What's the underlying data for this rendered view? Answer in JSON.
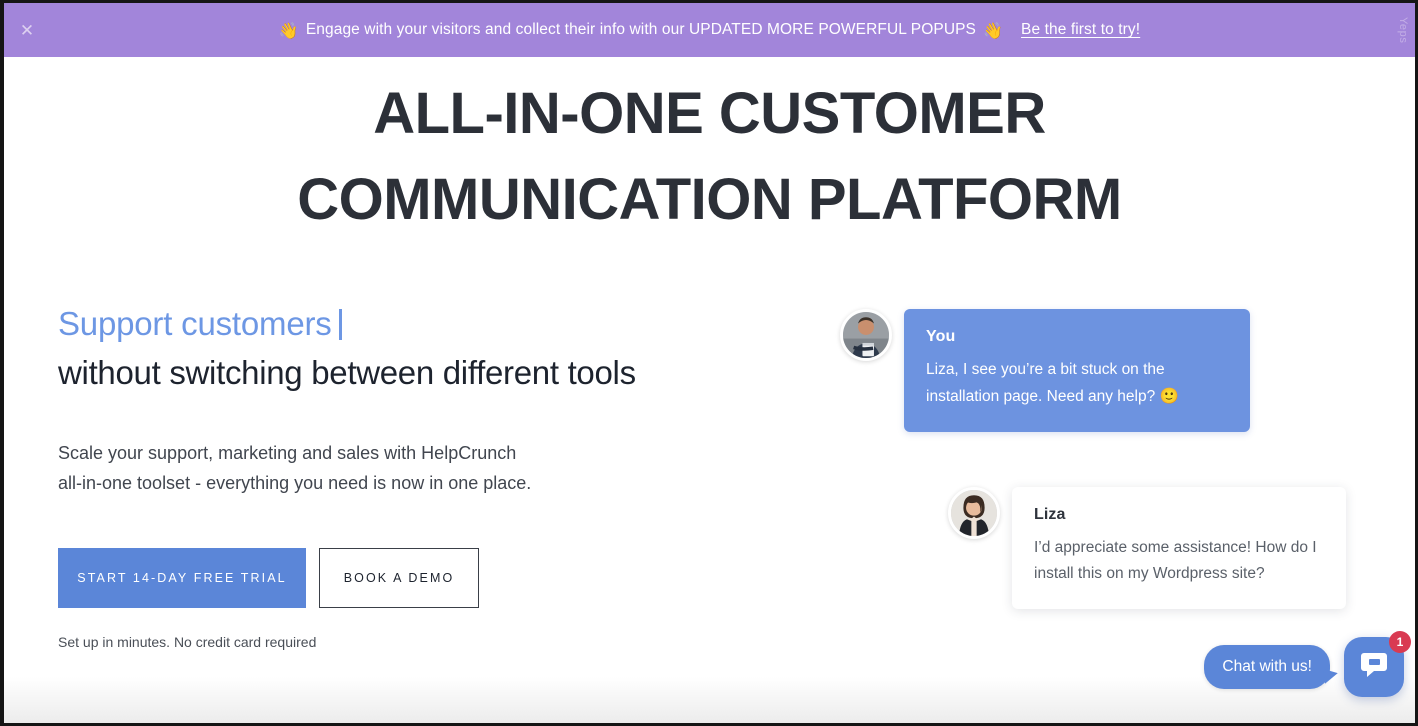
{
  "banner": {
    "close_label": "✕",
    "emoji_left": "👋",
    "emoji_right": "👋",
    "text": "Engage with your visitors and collect their info with our UPDATED MORE POWERFUL POPUPS",
    "cta": "Be the first to try!",
    "brand": "Yeps",
    "background_color": "#a285da"
  },
  "hero": {
    "title_line1": "ALL-IN-ONE CUSTOMER",
    "title_line2": "COMMUNICATION PLATFORM",
    "subhead_typed": "Support customers",
    "subhead_static": "without switching between different tools",
    "description_line1": "Scale your support, marketing and sales with HelpCrunch",
    "description_line2": "all-in-one toolset - everything you need is now in one place.",
    "primary_cta": "START 14-DAY FREE TRIAL",
    "secondary_cta": "BOOK A DEMO",
    "cta_note": "Set up in minutes. No credit card required",
    "accent_color": "#5b86d8",
    "typed_color": "#6d97e4"
  },
  "chat_mock": {
    "messages": [
      {
        "sender": "You",
        "text": "Liza, I see you’re a bit stuck on the installation page. Need any help?",
        "emoji": "🙂",
        "side": "agent",
        "bubble_color": "#6d93e0",
        "avatar_name": "avatar-you"
      },
      {
        "sender": "Liza",
        "text": "I’d appreciate some assistance! How do I install this on my Wordpress site?",
        "emoji": "",
        "side": "user",
        "bubble_color": "#ffffff",
        "avatar_name": "avatar-liza"
      }
    ]
  },
  "chat_widget": {
    "teaser": "Chat with us!",
    "badge_count": "1",
    "launcher_icon": "chat-bubble-icon",
    "color": "#5b86d8",
    "badge_color": "#d93a52"
  }
}
